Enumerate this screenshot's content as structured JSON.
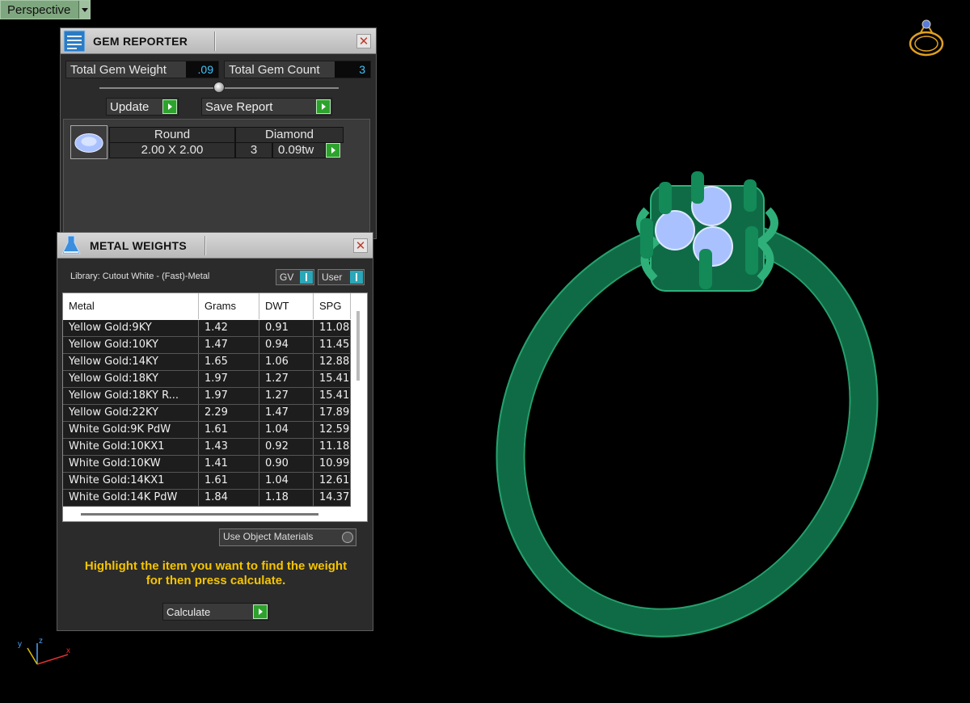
{
  "viewport": {
    "label": "Perspective",
    "background": "#000000",
    "model_color": "#0f6b46",
    "gem_color": "#a9c2ff",
    "axis_labels": {
      "x": "x",
      "y": "y",
      "z": "z"
    }
  },
  "gem_reporter": {
    "title": "GEM REPORTER",
    "total_weight_label": "Total Gem Weight",
    "total_weight_value": ".09",
    "total_count_label": "Total Gem Count",
    "total_count_value": "3",
    "update_label": "Update",
    "save_report_label": "Save Report",
    "gem": {
      "shape": "Round",
      "type": "Diamond",
      "size": "2.00 X 2.00",
      "count": "3",
      "weight": "0.09tw"
    }
  },
  "metal_weights": {
    "title": "METAL WEIGHTS",
    "library": "Library: Cutout White - (Fast)-Metal",
    "gv_label": "GV",
    "user_label": "User",
    "columns": [
      "Metal",
      "Grams",
      "DWT",
      "SPG"
    ],
    "rows": [
      [
        "Yellow Gold:9KY",
        "1.42",
        "0.91",
        "11.08"
      ],
      [
        "Yellow Gold:10KY",
        "1.47",
        "0.94",
        "11.45"
      ],
      [
        "Yellow Gold:14KY",
        "1.65",
        "1.06",
        "12.88"
      ],
      [
        "Yellow Gold:18KY",
        "1.97",
        "1.27",
        "15.41"
      ],
      [
        "Yellow Gold:18KY R...",
        "1.97",
        "1.27",
        "15.41"
      ],
      [
        "Yellow Gold:22KY",
        "2.29",
        "1.47",
        "17.89"
      ],
      [
        "White Gold:9K PdW",
        "1.61",
        "1.04",
        "12.59"
      ],
      [
        "White Gold:10KX1",
        "1.43",
        "0.92",
        "11.18"
      ],
      [
        "White Gold:10KW",
        "1.41",
        "0.90",
        "10.99"
      ],
      [
        "White Gold:14KX1",
        "1.61",
        "1.04",
        "12.61"
      ],
      [
        "White Gold:14K PdW",
        "1.84",
        "1.18",
        "14.37"
      ]
    ],
    "use_object_materials_label": "Use Object Materials",
    "instruction_line1": "Highlight the item you want to find the weight",
    "instruction_line2": "for then press calculate.",
    "calculate_label": "Calculate"
  }
}
